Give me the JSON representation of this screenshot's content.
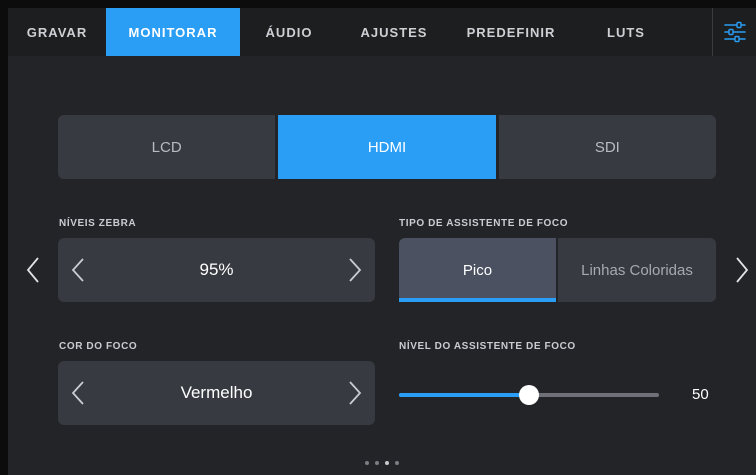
{
  "tabs": [
    {
      "label": "GRAVAR",
      "active": false
    },
    {
      "label": "MONITORAR",
      "active": true
    },
    {
      "label": "ÁUDIO",
      "active": false
    },
    {
      "label": "AJUSTES",
      "active": false
    },
    {
      "label": "PREDEFINIR",
      "active": false
    },
    {
      "label": "LUTS",
      "active": false
    }
  ],
  "settings_icon": "sliders-icon",
  "output_selector": {
    "options": [
      "LCD",
      "HDMI",
      "SDI"
    ],
    "selected": "HDMI"
  },
  "zebra": {
    "label": "NÍVEIS ZEBRA",
    "value": "95%"
  },
  "focus_assist_type": {
    "label": "TIPO DE ASSISTENTE DE FOCO",
    "options": [
      "Pico",
      "Linhas Coloridas"
    ],
    "selected": "Pico"
  },
  "focus_color": {
    "label": "COR DO FOCO",
    "value": "Vermelho"
  },
  "focus_assist_level": {
    "label": "NÍVEL DO ASSISTENTE DE FOCO",
    "value": "50",
    "fraction": 0.5
  },
  "pager": {
    "total": 4,
    "active_index": 2
  },
  "colors": {
    "accent": "#2a9df4",
    "panel": "#232428",
    "control": "#373a40",
    "tabbar": "#1d1e20"
  },
  "icons": {
    "prev_page": "chevron-left-icon",
    "next_page": "chevron-right-icon",
    "decrement": "chevron-left-icon",
    "increment": "chevron-right-icon"
  }
}
